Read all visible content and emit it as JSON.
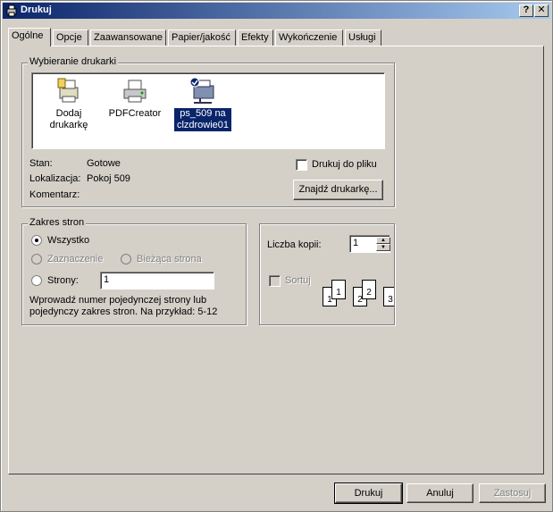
{
  "window": {
    "title": "Drukuj",
    "help_label": "?",
    "close_label": "✕"
  },
  "tabs": [
    {
      "label": "Ogólne",
      "active": true
    },
    {
      "label": "Opcje"
    },
    {
      "label": "Zaawansowane"
    },
    {
      "label": "Papier/jakość"
    },
    {
      "label": "Efekty"
    },
    {
      "label": "Wykończenie"
    },
    {
      "label": "Usługi"
    }
  ],
  "printer_select": {
    "legend": "Wybieranie drukarki",
    "printers": [
      {
        "label": "Dodaj drukarkę",
        "icon": "add-printer-icon"
      },
      {
        "label": "PDFCreator",
        "icon": "printer-icon"
      },
      {
        "label": "ps_509 na clzdrowie01",
        "icon": "network-printer-icon",
        "selected": true
      }
    ],
    "status_label": "Stan:",
    "status_value": "Gotowe",
    "location_label": "Lokalizacja:",
    "location_value": "Pokoj 509",
    "comment_label": "Komentarz:",
    "comment_value": "",
    "print_to_file_label": "Drukuj do pliku",
    "find_printer_label": "Znajdź drukarkę..."
  },
  "page_range": {
    "legend": "Zakres stron",
    "all_label": "Wszystko",
    "selection_label": "Zaznaczenie",
    "current_label": "Bieżąca strona",
    "pages_label": "Strony:",
    "pages_value": "1",
    "hint": "Wprowadź numer pojedynczej strony lub pojedynczy zakres stron. Na przykład: 5-12"
  },
  "copies": {
    "label": "Liczba kopii:",
    "value": "1",
    "collate_label": "Sortuj",
    "page_numbers": [
      "1",
      "1",
      "2",
      "2",
      "3"
    ]
  },
  "footer": {
    "print_label": "Drukuj",
    "cancel_label": "Anuluj",
    "apply_label": "Zastosuj"
  }
}
